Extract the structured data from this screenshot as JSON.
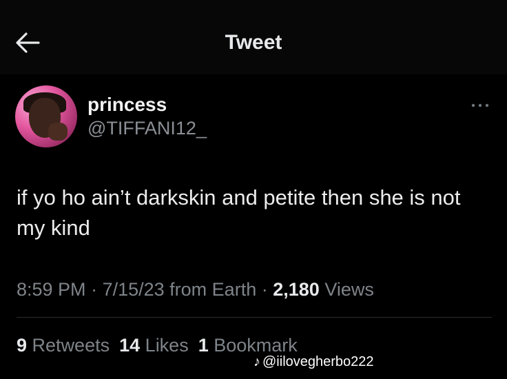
{
  "header": {
    "title": "Tweet",
    "back_icon": "arrow-left-icon"
  },
  "tweet": {
    "display_name": "princess",
    "handle": "@TIFFANI12_",
    "text": "if yo ho ain’t darkskin and petite then she is not my kind",
    "time": "8:59 PM",
    "date": "7/15/23",
    "source": "from Earth",
    "views_count": "2,180",
    "views_label": "Views",
    "retweets_count": "9",
    "retweets_label": "Retweets",
    "likes_count": "14",
    "likes_label": "Likes",
    "bookmarks_count": "1",
    "bookmarks_label": "Bookmark",
    "more_icon": "more-horizontal-icon"
  },
  "watermark": {
    "icon": "tiktok-icon",
    "text": "@iilovegherbo222"
  },
  "colors": {
    "background": "#000000",
    "primary_text": "#e7e9ea",
    "secondary_text": "#7e8489",
    "divider": "#2a2e31"
  }
}
